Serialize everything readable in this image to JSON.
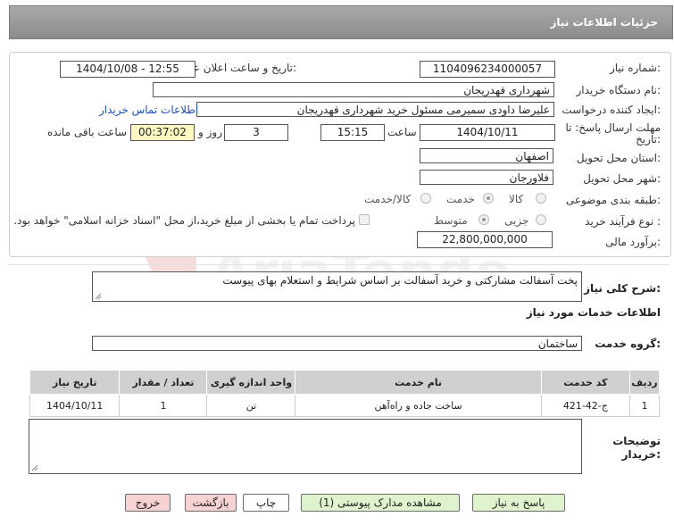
{
  "header": {
    "title": "جزئیات اطلاعات نیاز"
  },
  "form": {
    "need_number": {
      "label": "شماره نیاز:",
      "value": "1104096234000057"
    },
    "announce_datetime": {
      "label": "تاریخ و ساعت اعلان عمومی:",
      "value": "1404/10/08 - 12:55"
    },
    "buyer_org": {
      "label": "نام دستگاه خریدار:",
      "value": "شهرداری قهدریجان"
    },
    "requester": {
      "label": "ایجاد کننده درخواست:",
      "value": "علیرضا داودی سمیرمی مسئول خرید  شهرداری قهدریجان"
    },
    "contact_link": "اطلاعات تماس خریدار",
    "deadline": {
      "label_line1": "مهلت ارسال پاسخ: تا",
      "label_line2": "تاریخ:",
      "date": "1404/10/11",
      "time_label": "ساعت",
      "time": "15:15",
      "days": "3",
      "days_label": "روز و",
      "remaining": "00:37:02",
      "remaining_label": "ساعت باقی مانده"
    },
    "province": {
      "label": "استان محل تحویل:",
      "value": "اصفهان"
    },
    "city": {
      "label": "شهر محل تحویل:",
      "value": "فلاورجان"
    },
    "category": {
      "label": "طبقه بندی موضوعی:",
      "options": [
        "کالا",
        "خدمت",
        "کالا/خدمت"
      ],
      "selected": "خدمت"
    },
    "process_type": {
      "label": "نوع فرآیند خرید :",
      "options": [
        "جزیی",
        "متوسط"
      ],
      "selected": "متوسط",
      "treasury_note": "پرداخت تمام یا بخشی از مبلغ خرید،از محل \"اسناد خزانه اسلامی\" خواهد بود."
    },
    "budget": {
      "label": "برآورد مالی:",
      "value": "22,800,000,000"
    }
  },
  "description": {
    "label": "شرح کلی نیاز:",
    "value": "پخت آسفالت مشارکتی و خرید آسفالت بر اساس شرایط و استعلام بهای پیوست"
  },
  "services": {
    "section_title": "اطلاعات خدمات مورد نیاز",
    "group_label": "گروه خدمت:",
    "group_value": "ساختمان",
    "columns": [
      "ردیف",
      "کد خدمت",
      "نام خدمت",
      "واحد اندازه گیری",
      "تعداد / مقدار",
      "تاریخ نیاز"
    ],
    "rows": [
      [
        "1",
        "ج-42-421",
        "ساخت جاده و راه‌آهن",
        "تن",
        "1",
        "1404/10/11"
      ]
    ]
  },
  "buyer_notes": {
    "label_line1": "توضیحات",
    "label_line2": "خریدار:",
    "value": ""
  },
  "buttons": {
    "reply": "پاسخ به نیاز",
    "attachments": "مشاهده مدارک پیوستی (1)",
    "print": "چاپ",
    "back": "بازگشت",
    "exit": "خروج"
  },
  "watermark": "AriaTender.net"
}
